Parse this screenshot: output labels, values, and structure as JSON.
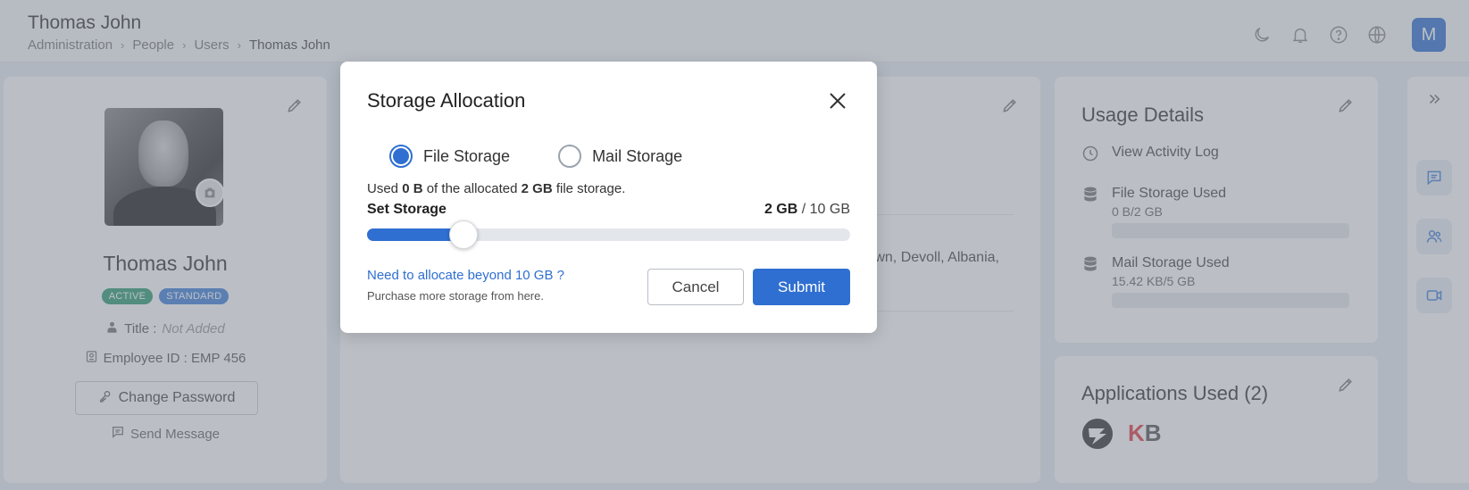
{
  "header": {
    "title": "Thomas John",
    "breadcrumb": [
      "Administration",
      "People",
      "Users",
      "Thomas John"
    ],
    "avatar_letter": "M",
    "icons": [
      "moon-icon",
      "bell-icon",
      "help-icon",
      "globe-icon"
    ]
  },
  "profile": {
    "name": "Thomas John",
    "badges": [
      "ACTIVE",
      "STANDARD"
    ],
    "title_label": "Title :",
    "title_value": "Not Added",
    "employee_id": "Employee ID : EMP 456",
    "change_password": "Change Password",
    "send_message": "Send Message"
  },
  "middle": {
    "address_fragment": "town, Devoll, Albania,"
  },
  "usage": {
    "title": "Usage Details",
    "activity_log": "View Activity Log",
    "file_storage_label": "File Storage Used",
    "file_storage_value": "0 B/2 GB",
    "file_storage_fraction": 0,
    "mail_storage_label": "Mail Storage Used",
    "mail_storage_value": "15.42 KB/5 GB",
    "mail_storage_fraction": 0
  },
  "apps": {
    "title": "Applications Used (2)",
    "kb_logo": "KB"
  },
  "modal": {
    "title": "Storage Allocation",
    "radio_file": "File Storage",
    "radio_mail": "Mail Storage",
    "selected": "file",
    "used_prefix": "Used",
    "used_amount": "0 B",
    "used_middle": "of the allocated",
    "allocated": "2 GB",
    "used_suffix": "file storage.",
    "set_label": "Set Storage",
    "set_current": "2 GB",
    "set_max": "/ 10 GB",
    "slider_value_gb": 2,
    "slider_max_gb": 10,
    "need_link": "Need to allocate beyond 10 GB ?",
    "purchase_text": "Purchase more storage from here.",
    "cancel": "Cancel",
    "submit": "Submit"
  },
  "colors": {
    "accent": "#2f6fd1",
    "active_badge": "#2d9b72"
  }
}
